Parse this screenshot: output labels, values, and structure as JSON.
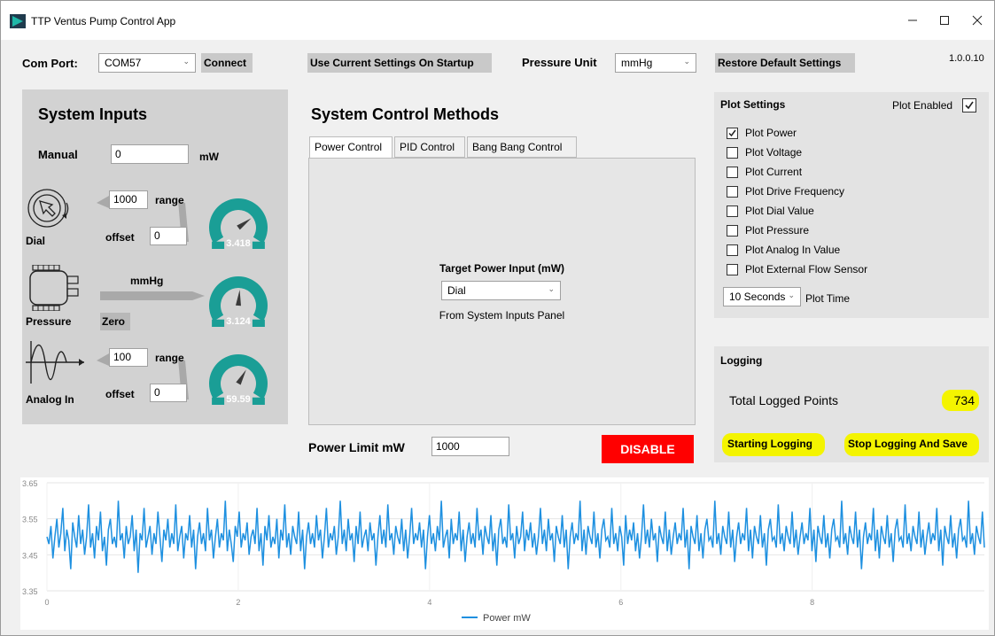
{
  "window": {
    "title": "TTP Ventus Pump Control App",
    "version": "1.0.0.10"
  },
  "toolbar": {
    "com_port_label": "Com Port:",
    "com_port_value": "COM57",
    "connect_label": "Connect",
    "use_settings_label": "Use Current Settings On Startup",
    "pressure_unit_label": "Pressure Unit",
    "pressure_unit_value": "mmHg",
    "restore_label": "Restore Default Settings"
  },
  "system_inputs": {
    "title": "System Inputs",
    "manual_label": "Manual",
    "manual_value": "0",
    "manual_unit": "mW",
    "dial_label": "Dial",
    "dial_range_value": "1000",
    "dial_range_label": "range",
    "dial_offset_label": "offset",
    "dial_offset_value": "0",
    "dial_gauge_value": "3.418",
    "dial_gauge_level": 0.72,
    "pressure_label": "Pressure",
    "pressure_unit": "mmHg",
    "zero_label": "Zero",
    "pressure_gauge_value": "3.124",
    "pressure_gauge_level": 0.52,
    "analog_label": "Analog In",
    "analog_range_value": "100",
    "analog_range_label": "range",
    "analog_offset_label": "offset",
    "analog_offset_value": "0",
    "analog_gauge_value": "59.59",
    "analog_gauge_level": 0.62
  },
  "control": {
    "title": "System Control Methods",
    "tabs": [
      "Power Control",
      "PID Control",
      "Bang Bang Control"
    ],
    "target_label": "Target Power Input (mW)",
    "target_value": "Dial",
    "target_source": "From System Inputs Panel",
    "power_limit_label": "Power Limit mW",
    "power_limit_value": "1000",
    "disable_label": "DISABLE"
  },
  "plot_settings": {
    "title": "Plot Settings",
    "plot_enabled_label": "Plot Enabled",
    "plot_enabled_checked": true,
    "options": [
      {
        "label": "Plot Power",
        "checked": true
      },
      {
        "label": "Plot Voltage",
        "checked": false
      },
      {
        "label": "Plot Current",
        "checked": false
      },
      {
        "label": "Plot Drive Frequency",
        "checked": false
      },
      {
        "label": "Plot Dial Value",
        "checked": false
      },
      {
        "label": "Plot Pressure",
        "checked": false
      },
      {
        "label": "Plot Analog In Value",
        "checked": false
      },
      {
        "label": "Plot External Flow Sensor",
        "checked": false
      }
    ],
    "plot_time_value": "10 Seconds",
    "plot_time_label": "Plot Time"
  },
  "logging": {
    "title": "Logging",
    "total_label": "Total Logged Points",
    "total_value": "734",
    "start_label": "Starting Logging",
    "stop_label": "Stop Logging And Save"
  },
  "colors": {
    "accent": "#1a9e96",
    "series": "#1e90e0",
    "disable": "#ff0000",
    "highlight": "#f4f400"
  },
  "chart_data": {
    "type": "line",
    "title": "",
    "xlabel": "",
    "ylabel": "",
    "xlim": [
      0,
      9.8
    ],
    "ylim": [
      3.35,
      3.65
    ],
    "x_ticks": [
      "0",
      "2",
      "4",
      "6",
      "8"
    ],
    "y_ticks": [
      "3.65",
      "3.55",
      "3.45",
      "3.35"
    ],
    "grid": true,
    "legend_position": "bottom",
    "series": [
      {
        "name": "Power mW",
        "values": [
          3.5,
          3.48,
          3.53,
          3.44,
          3.5,
          3.55,
          3.47,
          3.51,
          3.58,
          3.46,
          3.52,
          3.49,
          3.41,
          3.54,
          3.5,
          3.47,
          3.56,
          3.48,
          3.52,
          3.45,
          3.5,
          3.59,
          3.47,
          3.51,
          3.44,
          3.53,
          3.49,
          3.57,
          3.46,
          3.5,
          3.42,
          3.52,
          3.55,
          3.48,
          3.5,
          3.47,
          3.6,
          3.49,
          3.51,
          3.44,
          3.53,
          3.48,
          3.5,
          3.56,
          3.46,
          3.52,
          3.4,
          3.51,
          3.49,
          3.58,
          3.47,
          3.5,
          3.53,
          3.45,
          3.51,
          3.48,
          3.57,
          3.5,
          3.43,
          3.52,
          3.49,
          3.55,
          3.47,
          3.51,
          3.48,
          3.59,
          3.46,
          3.5,
          3.53,
          3.44,
          3.51,
          3.49,
          3.56,
          3.47,
          3.52,
          3.41,
          3.5,
          3.54,
          3.48,
          3.51,
          3.46,
          3.58,
          3.49,
          3.52,
          3.44,
          3.5,
          3.55,
          3.47,
          3.51,
          3.49,
          3.6,
          3.46,
          3.52,
          3.48,
          3.43,
          3.53,
          3.5,
          3.57,
          3.47,
          3.51,
          3.49,
          3.54,
          3.45,
          3.5,
          3.52,
          3.48,
          3.58,
          3.46,
          3.51,
          3.42,
          3.53,
          3.49,
          3.56,
          3.47,
          3.5,
          3.48,
          3.55,
          3.44,
          3.52,
          3.49,
          3.59,
          3.47,
          3.51,
          3.45,
          3.53,
          3.5,
          3.48,
          3.57,
          3.46,
          3.52,
          3.41,
          3.5,
          3.54,
          3.48,
          3.51,
          3.47,
          3.56,
          3.49,
          3.52,
          3.44,
          3.5,
          3.58,
          3.47,
          3.51,
          3.49,
          3.53,
          3.45,
          3.5,
          3.6,
          3.48,
          3.52,
          3.46,
          3.55,
          3.49,
          3.51,
          3.43,
          3.53,
          3.48,
          3.57,
          3.47,
          3.5,
          3.52,
          3.46,
          3.54,
          3.49,
          3.51,
          3.42,
          3.5,
          3.56,
          3.48,
          3.52,
          3.47,
          3.59,
          3.49,
          3.51,
          3.45,
          3.53,
          3.5,
          3.48,
          3.55,
          3.46,
          3.52,
          3.44,
          3.5,
          3.58,
          3.48,
          3.51,
          3.49,
          3.54,
          3.47,
          3.52,
          3.41,
          3.5,
          3.56,
          3.48,
          3.51,
          3.46,
          3.53,
          3.49,
          3.6,
          3.47,
          3.5,
          3.52,
          3.44,
          3.55,
          3.48,
          3.51,
          3.49,
          3.57,
          3.46,
          3.52,
          3.43,
          3.5,
          3.54,
          3.48,
          3.51,
          3.47,
          3.58,
          3.49,
          3.52,
          3.45,
          3.53,
          3.5,
          3.48,
          3.56,
          3.46,
          3.51,
          3.42,
          3.52,
          3.55,
          3.48,
          3.5,
          3.47,
          3.59,
          3.49,
          3.51,
          3.44,
          3.53,
          3.48,
          3.5,
          3.57,
          3.46,
          3.52,
          3.49,
          3.54,
          3.47,
          3.51,
          3.45,
          3.5,
          3.58,
          3.48,
          3.52,
          3.46,
          3.55,
          3.49,
          3.51,
          3.43,
          3.53,
          3.5,
          3.48,
          3.56,
          3.47,
          3.52,
          3.41,
          3.5,
          3.54,
          3.48,
          3.51,
          3.49,
          3.6,
          3.46,
          3.52,
          3.45,
          3.53,
          3.5,
          3.48,
          3.57,
          3.47,
          3.51,
          3.44,
          3.52,
          3.55,
          3.49,
          3.5,
          3.47,
          3.58,
          3.48,
          3.51,
          3.46,
          3.53,
          3.5,
          3.42,
          3.56,
          3.48,
          3.52,
          3.49,
          3.54,
          3.46,
          3.51,
          3.44,
          3.5,
          3.59,
          3.48,
          3.52,
          3.47,
          3.55,
          3.49,
          3.51,
          3.43,
          3.53,
          3.5,
          3.48,
          3.57,
          3.46,
          3.52,
          3.45,
          3.5,
          3.54,
          3.48,
          3.51,
          3.49,
          3.58,
          3.47,
          3.52,
          3.41,
          3.53,
          3.5,
          3.48,
          3.56,
          3.46,
          3.51,
          3.44,
          3.52,
          3.55,
          3.49,
          3.5,
          3.47,
          3.6,
          3.48,
          3.51,
          3.45,
          3.53,
          3.5,
          3.48,
          3.57,
          3.47,
          3.52,
          3.43,
          3.5,
          3.54,
          3.48,
          3.51,
          3.49,
          3.58,
          3.46,
          3.52,
          3.44,
          3.53,
          3.5,
          3.48,
          3.56,
          3.47,
          3.51,
          3.42,
          3.52,
          3.55,
          3.49,
          3.5,
          3.47,
          3.59,
          3.48,
          3.51,
          3.46,
          3.53,
          3.5,
          3.48,
          3.57,
          3.47,
          3.52,
          3.45,
          3.5,
          3.54,
          3.48,
          3.51,
          3.49,
          3.58,
          3.46,
          3.52,
          3.43,
          3.53,
          3.5,
          3.48,
          3.56,
          3.47,
          3.51,
          3.44,
          3.52,
          3.55,
          3.49,
          3.5,
          3.47,
          3.6,
          3.48,
          3.51,
          3.45,
          3.53,
          3.5,
          3.48,
          3.57,
          3.47,
          3.52,
          3.41,
          3.5,
          3.54,
          3.48,
          3.51,
          3.49,
          3.58,
          3.46,
          3.52,
          3.44,
          3.53,
          3.5,
          3.48,
          3.56,
          3.47,
          3.51,
          3.43,
          3.52,
          3.55,
          3.49,
          3.5,
          3.47,
          3.59,
          3.48,
          3.51,
          3.46,
          3.53,
          3.5,
          3.48,
          3.57,
          3.47,
          3.52,
          3.45,
          3.5,
          3.54,
          3.48,
          3.51,
          3.49,
          3.58,
          3.46,
          3.52,
          3.42,
          3.53,
          3.5,
          3.48,
          3.56,
          3.47,
          3.51,
          3.44,
          3.52,
          3.55,
          3.49,
          3.5,
          3.47,
          3.6,
          3.48,
          3.51,
          3.45,
          3.53,
          3.5,
          3.48,
          3.57,
          3.47
        ]
      }
    ]
  }
}
